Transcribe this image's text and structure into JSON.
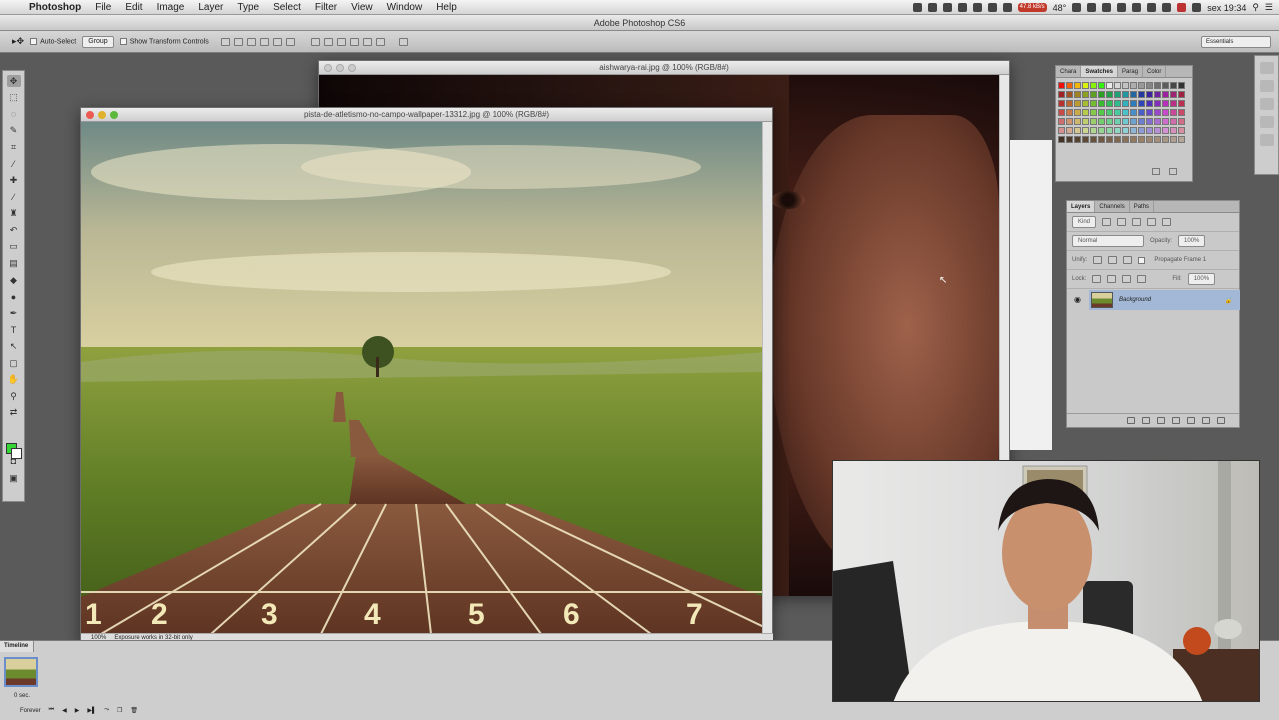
{
  "menubar": {
    "app": "Photoshop",
    "items": [
      "File",
      "Edit",
      "Image",
      "Layer",
      "Type",
      "Select",
      "Filter",
      "View",
      "Window",
      "Help"
    ],
    "status": {
      "temp": "48°",
      "day_time": "sex 19:34",
      "net": "47.8 kB/s"
    }
  },
  "window_title": "Adobe Photoshop CS6",
  "options": {
    "auto_select": "Auto-Select",
    "group": "Group",
    "transform": "Show Transform Controls",
    "workspace": "Essentials"
  },
  "doc1": {
    "title": "aishwarya-rai.jpg @ 100% (RGB/8#)"
  },
  "doc2": {
    "title": "pista-de-atletismo-no-campo-wallpaper-13312.jpg @ 100% (RGB/8#)",
    "zoom": "100%",
    "status": "Exposure works in 32-bit only",
    "lane_numbers": [
      "1",
      "2",
      "3",
      "4",
      "5",
      "6",
      "7"
    ]
  },
  "swatch_panel": {
    "tabs": [
      "Chara",
      "Swatches",
      "Parag",
      "Color"
    ]
  },
  "layers_panel": {
    "tabs": [
      "Layers",
      "Channels",
      "Paths"
    ],
    "kind": "Kind",
    "blend": "Normal",
    "opacity_label": "Opacity:",
    "opacity": "100%",
    "unify": "Unify:",
    "propagate": "Propagate Frame 1",
    "lock": "Lock:",
    "fill_label": "Fill:",
    "fill": "100%",
    "layer_name": "Background"
  },
  "timeline": {
    "tab": "Timeline",
    "frame_delay": "0 sec.",
    "loop": "Forever"
  },
  "colors": {
    "foreground": "#37d437",
    "background": "#ffffff",
    "selected_layer": "#a3b7d6"
  }
}
